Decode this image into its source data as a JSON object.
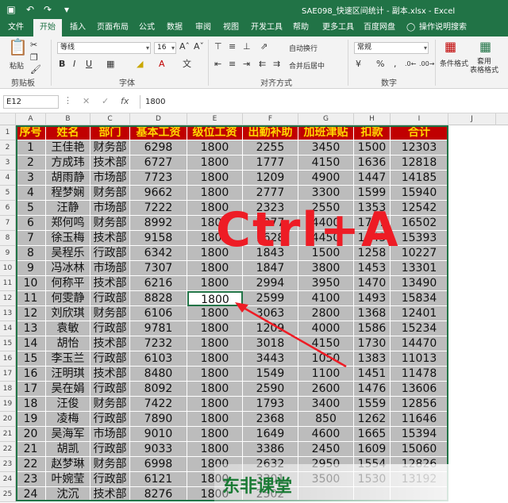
{
  "window": {
    "title": "SAE098_快速区间统计 - 副本.xlsx  -  Excel"
  },
  "ribbon": {
    "tabs": [
      "文件",
      "开始",
      "插入",
      "页面布局",
      "公式",
      "数据",
      "审阅",
      "视图",
      "开发工具",
      "帮助",
      "更多工具",
      "百度网盘",
      "操作说明搜索"
    ],
    "active_tab": "开始",
    "clipboard": {
      "paste_label": "粘贴",
      "group_label": "剪贴板"
    },
    "font": {
      "name": "等线",
      "size": "16",
      "group_label": "字体"
    },
    "alignment": {
      "wrap_label": "自动换行",
      "merge_label": "合并后居中",
      "group_label": "对齐方式"
    },
    "number": {
      "format": "常规",
      "group_label": "数字"
    },
    "styles": {
      "cond_format_label": "条件格式",
      "table_format_label": "套用\n表格格式"
    }
  },
  "formula_bar": {
    "name_box": "E12",
    "fx_label": "fx",
    "value": "1800"
  },
  "sheet": {
    "columns": [
      "A",
      "B",
      "C",
      "D",
      "E",
      "F",
      "G",
      "H",
      "I",
      "J"
    ],
    "header": [
      "序号",
      "姓名",
      "部门",
      "基本工资",
      "级位工资",
      "出勤补助",
      "加班津贴",
      "扣款",
      "合计"
    ],
    "rows": [
      [
        "1",
        "王佳艳",
        "财务部",
        "6298",
        "1800",
        "2255",
        "3450",
        "1500",
        "12303"
      ],
      [
        "2",
        "方成玮",
        "技术部",
        "6727",
        "1800",
        "1777",
        "4150",
        "1636",
        "12818"
      ],
      [
        "3",
        "胡雨静",
        "市场部",
        "7723",
        "1800",
        "1209",
        "4900",
        "1447",
        "14185"
      ],
      [
        "4",
        "程梦娴",
        "财务部",
        "9662",
        "1800",
        "2777",
        "3300",
        "1599",
        "15940"
      ],
      [
        "5",
        "汪静",
        "市场部",
        "7222",
        "1800",
        "2323",
        "2550",
        "1353",
        "12542"
      ],
      [
        "6",
        "郑何鸣",
        "财务部",
        "8992",
        "1800",
        "2077",
        "4400",
        "1767",
        "16502"
      ],
      [
        "7",
        "徐玉梅",
        "技术部",
        "9158",
        "1800",
        "1628",
        "4450",
        "1643",
        "15393"
      ],
      [
        "8",
        "吴程乐",
        "行政部",
        "6342",
        "1800",
        "1843",
        "1500",
        "1258",
        "10227"
      ],
      [
        "9",
        "冯冰林",
        "市场部",
        "7307",
        "1800",
        "1847",
        "3800",
        "1453",
        "13301"
      ],
      [
        "10",
        "何称平",
        "技术部",
        "6216",
        "1800",
        "2994",
        "3950",
        "1470",
        "13490"
      ],
      [
        "11",
        "何雯静",
        "行政部",
        "8828",
        "1800",
        "2599",
        "4100",
        "1493",
        "15834"
      ],
      [
        "12",
        "刘欣琪",
        "财务部",
        "6106",
        "1800",
        "3063",
        "2800",
        "1368",
        "12401"
      ],
      [
        "13",
        "袁敏",
        "行政部",
        "9781",
        "1800",
        "1209",
        "4000",
        "1586",
        "15234"
      ],
      [
        "14",
        "胡怡",
        "技术部",
        "7232",
        "1800",
        "3018",
        "4150",
        "1730",
        "14470"
      ],
      [
        "15",
        "李玉兰",
        "行政部",
        "6103",
        "1800",
        "3443",
        "1050",
        "1383",
        "11013"
      ],
      [
        "16",
        "汪明琪",
        "技术部",
        "8480",
        "1800",
        "1549",
        "1100",
        "1451",
        "11478"
      ],
      [
        "17",
        "吴在娟",
        "行政部",
        "8092",
        "1800",
        "2590",
        "2600",
        "1476",
        "13606"
      ],
      [
        "18",
        "汪俊",
        "财务部",
        "7422",
        "1800",
        "1793",
        "3400",
        "1559",
        "12856"
      ],
      [
        "19",
        "凌梅",
        "行政部",
        "7890",
        "1800",
        "2368",
        "850",
        "1262",
        "11646"
      ],
      [
        "20",
        "吴海军",
        "市场部",
        "9010",
        "1800",
        "1649",
        "4600",
        "1665",
        "15394"
      ],
      [
        "21",
        "胡凯",
        "行政部",
        "9033",
        "1800",
        "3386",
        "2450",
        "1609",
        "15060"
      ],
      [
        "22",
        "赵梦琳",
        "财务部",
        "6998",
        "1800",
        "2632",
        "2950",
        "1554",
        "12826"
      ],
      [
        "23",
        "叶婉莹",
        "行政部",
        "6121",
        "1800",
        "3301",
        "3500",
        "1530",
        "13192"
      ],
      [
        "24",
        "沈沉",
        "技术部",
        "8276",
        "1800",
        "2502",
        "",
        "",
        ""
      ]
    ],
    "row_numbers": [
      "1",
      "2",
      "3",
      "4",
      "5",
      "6",
      "7",
      "8",
      "9",
      "10",
      "11",
      "12",
      "13",
      "14",
      "15",
      "16",
      "17",
      "18",
      "19",
      "20",
      "21",
      "22",
      "23",
      "24",
      "25"
    ]
  },
  "overlay": {
    "shortcut_text": "Ctrl+A",
    "watermark": "东非课堂"
  },
  "colors": {
    "excel_green": "#217346",
    "header_fill": "#c00000",
    "header_text": "#ffd700",
    "selection_fill": "#bcbcbc",
    "annotation_red": "#ee1c25"
  }
}
